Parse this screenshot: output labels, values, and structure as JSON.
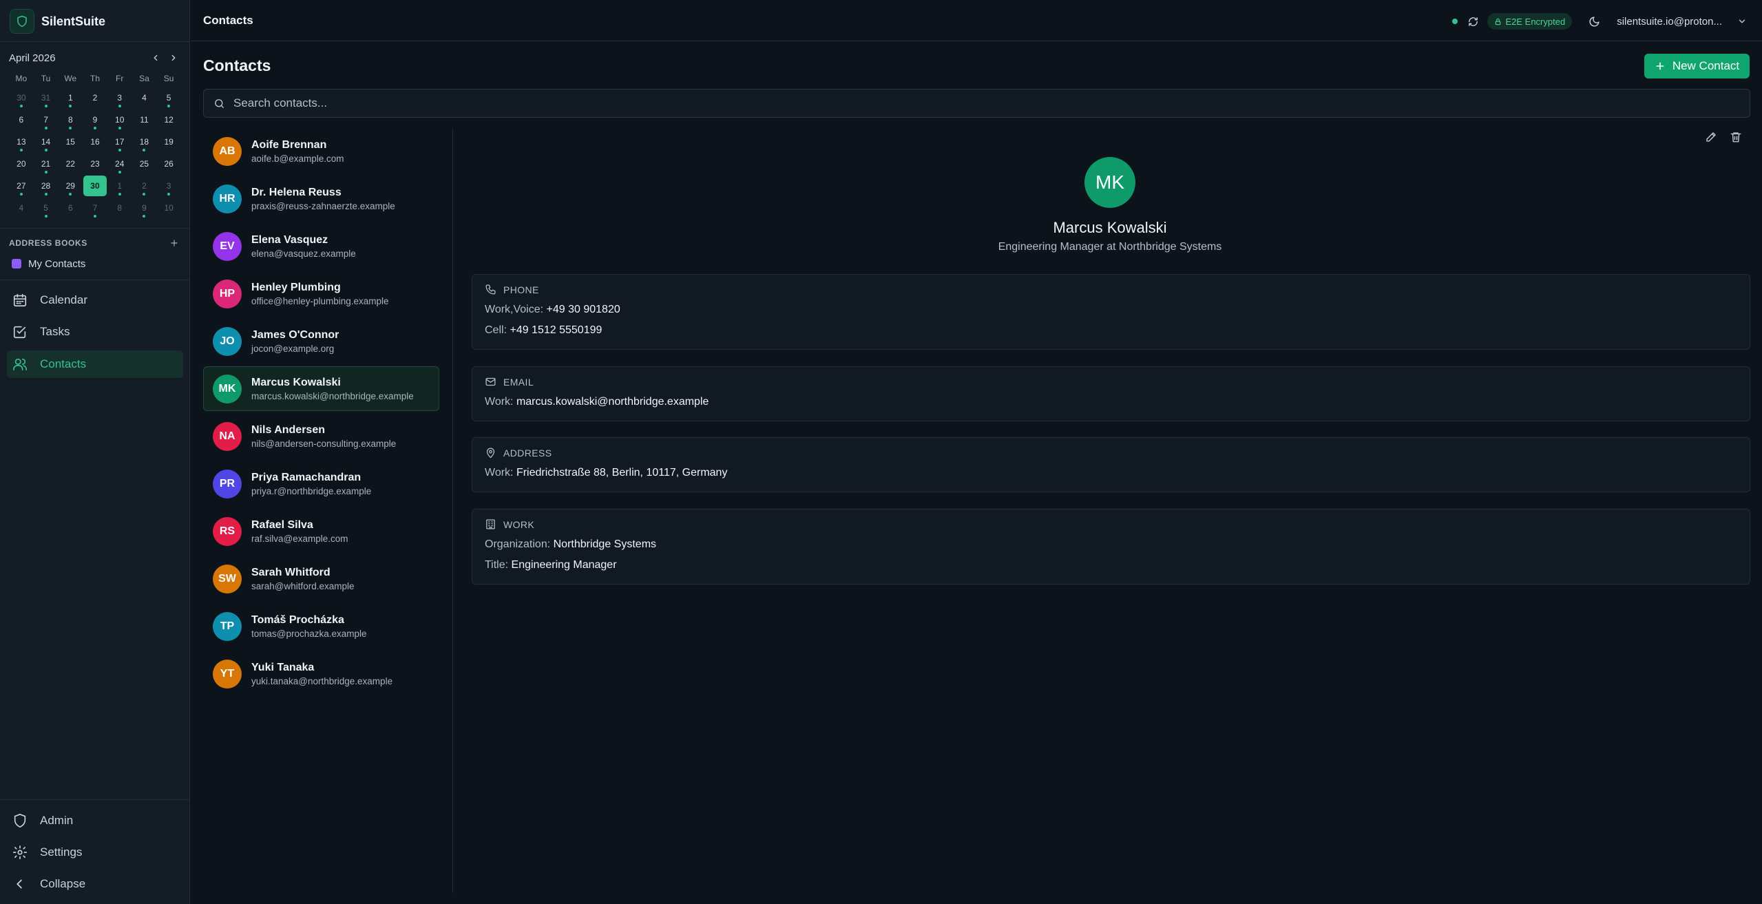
{
  "app": {
    "name": "SilentSuite"
  },
  "calendar": {
    "month_label": "April 2026",
    "weekdays": [
      "Mo",
      "Tu",
      "We",
      "Th",
      "Fr",
      "Sa",
      "Su"
    ],
    "days": [
      {
        "d": "30",
        "other": true,
        "dot": true
      },
      {
        "d": "31",
        "other": true,
        "dot": true
      },
      {
        "d": "1",
        "dot": true
      },
      {
        "d": "2"
      },
      {
        "d": "3",
        "dot": true
      },
      {
        "d": "4"
      },
      {
        "d": "5",
        "dot": true
      },
      {
        "d": "6"
      },
      {
        "d": "7",
        "dot": true
      },
      {
        "d": "8",
        "dot": true
      },
      {
        "d": "9",
        "dot": true
      },
      {
        "d": "10",
        "dot": true
      },
      {
        "d": "11"
      },
      {
        "d": "12"
      },
      {
        "d": "13",
        "dot": true
      },
      {
        "d": "14",
        "dot": true
      },
      {
        "d": "15"
      },
      {
        "d": "16"
      },
      {
        "d": "17",
        "dot": true
      },
      {
        "d": "18",
        "dot": true
      },
      {
        "d": "19"
      },
      {
        "d": "20"
      },
      {
        "d": "21",
        "dot": true
      },
      {
        "d": "22"
      },
      {
        "d": "23"
      },
      {
        "d": "24",
        "dot": true
      },
      {
        "d": "25"
      },
      {
        "d": "26"
      },
      {
        "d": "27",
        "dot": true
      },
      {
        "d": "28",
        "dot": true
      },
      {
        "d": "29",
        "dot": true
      },
      {
        "d": "30",
        "today": true
      },
      {
        "d": "1",
        "other": true,
        "dot": true
      },
      {
        "d": "2",
        "other": true,
        "dot": true
      },
      {
        "d": "3",
        "other": true,
        "dot": true
      },
      {
        "d": "4",
        "other": true
      },
      {
        "d": "5",
        "other": true,
        "dot": true
      },
      {
        "d": "6",
        "other": true
      },
      {
        "d": "7",
        "other": true,
        "dot": true
      },
      {
        "d": "8",
        "other": true
      },
      {
        "d": "9",
        "other": true,
        "dot": true
      },
      {
        "d": "10",
        "other": true
      }
    ]
  },
  "address_books": {
    "title": "ADDRESS BOOKS",
    "items": [
      {
        "label": "My Contacts",
        "color": "#8b5cf6"
      }
    ]
  },
  "nav": {
    "calendar": "Calendar",
    "tasks": "Tasks",
    "contacts": "Contacts",
    "admin": "Admin",
    "settings": "Settings",
    "collapse": "Collapse"
  },
  "topbar": {
    "title": "Contacts",
    "badge": "E2E Encrypted",
    "account": "silentsuite.io@proton..."
  },
  "page": {
    "title": "Contacts",
    "new_button": "New Contact",
    "search_placeholder": "Search contacts..."
  },
  "contacts": [
    {
      "initials": "AB",
      "name": "Aoife Brennan",
      "email": "aoife.b@example.com",
      "color": "#d97706"
    },
    {
      "initials": "HR",
      "name": "Dr. Helena Reuss",
      "email": "praxis@reuss-zahnaerzte.example",
      "color": "#0e8fb0"
    },
    {
      "initials": "EV",
      "name": "Elena Vasquez",
      "email": "elena@vasquez.example",
      "color": "#9333ea"
    },
    {
      "initials": "HP",
      "name": "Henley Plumbing",
      "email": "office@henley-plumbing.example",
      "color": "#db2777"
    },
    {
      "initials": "JO",
      "name": "James O'Connor",
      "email": "jocon@example.org",
      "color": "#0e8fb0"
    },
    {
      "initials": "MK",
      "name": "Marcus Kowalski",
      "email": "marcus.kowalski@northbridge.example",
      "color": "#0f9a6a",
      "selected": true
    },
    {
      "initials": "NA",
      "name": "Nils Andersen",
      "email": "nils@andersen-consulting.example",
      "color": "#e11d48"
    },
    {
      "initials": "PR",
      "name": "Priya Ramachandran",
      "email": "priya.r@northbridge.example",
      "color": "#4f46e5"
    },
    {
      "initials": "RS",
      "name": "Rafael Silva",
      "email": "raf.silva@example.com",
      "color": "#e11d48"
    },
    {
      "initials": "SW",
      "name": "Sarah Whitford",
      "email": "sarah@whitford.example",
      "color": "#d97706"
    },
    {
      "initials": "TP",
      "name": "Tomáš Procházka",
      "email": "tomas@prochazka.example",
      "color": "#0e8fb0"
    },
    {
      "initials": "YT",
      "name": "Yuki Tanaka",
      "email": "yuki.tanaka@northbridge.example",
      "color": "#d97706"
    }
  ],
  "detail": {
    "initials": "MK",
    "name": "Marcus Kowalski",
    "subtitle": "Engineering Manager at Northbridge Systems",
    "phone": {
      "label": "PHONE",
      "rows": [
        {
          "key": "Work,Voice:",
          "value": "+49 30 901820"
        },
        {
          "key": "Cell:",
          "value": "+49 1512 5550199"
        }
      ]
    },
    "email": {
      "label": "EMAIL",
      "rows": [
        {
          "key": "Work:",
          "value": "marcus.kowalski@northbridge.example"
        }
      ]
    },
    "address": {
      "label": "ADDRESS",
      "rows": [
        {
          "key": "Work:",
          "value": "Friedrichstraße 88, Berlin, 10117, Germany"
        }
      ]
    },
    "work": {
      "label": "WORK",
      "rows": [
        {
          "key": "Organization:",
          "value": "Northbridge Systems"
        },
        {
          "key": "Title:",
          "value": "Engineering Manager"
        }
      ]
    }
  },
  "colors": {
    "accent": "#34c38f",
    "button": "#10a46f"
  }
}
